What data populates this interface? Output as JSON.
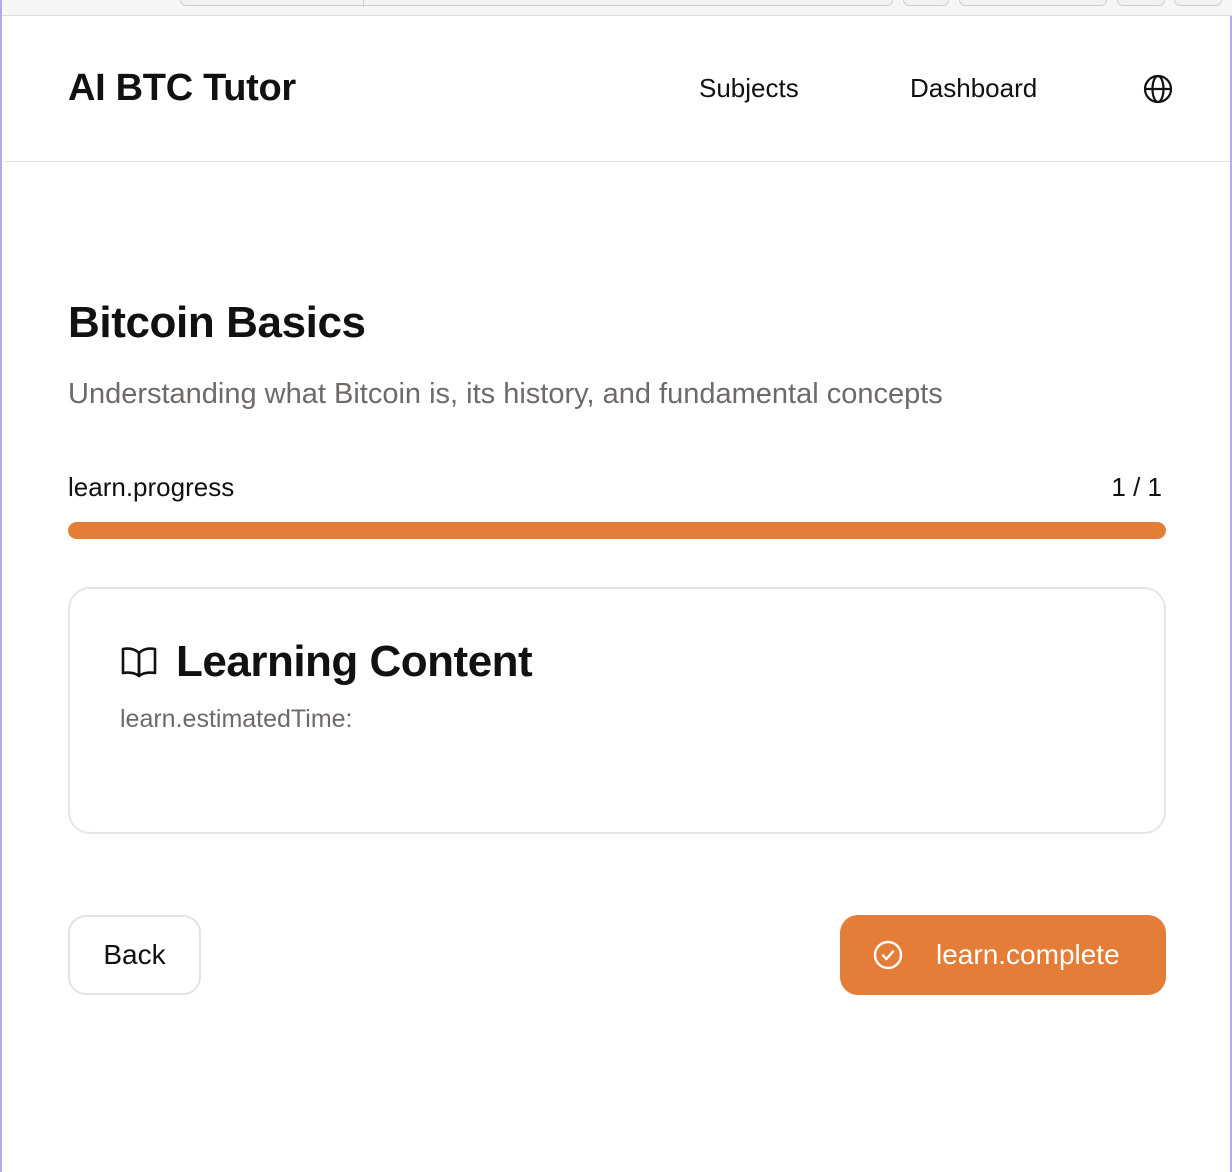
{
  "header": {
    "brand": "AI BTC Tutor",
    "nav": {
      "subjects": "Subjects",
      "dashboard": "Dashboard"
    },
    "language_icon": "globe-icon"
  },
  "lesson": {
    "title": "Bitcoin Basics",
    "subtitle": "Understanding what Bitcoin is, its history, and fundamental concepts",
    "progress": {
      "label": "learn.progress",
      "count": "1 / 1",
      "current": 1,
      "total": 1,
      "fraction": 1.0
    },
    "content_card": {
      "icon": "open-book-icon",
      "title": "Learning Content",
      "meta": "learn.estimatedTime:"
    }
  },
  "actions": {
    "back_label": "Back",
    "complete_label": "learn.complete",
    "complete_icon": "check-circle-icon"
  },
  "colors": {
    "accent": "#e47d37",
    "muted_text": "#6f6a67",
    "border": "#e6e6e6"
  }
}
